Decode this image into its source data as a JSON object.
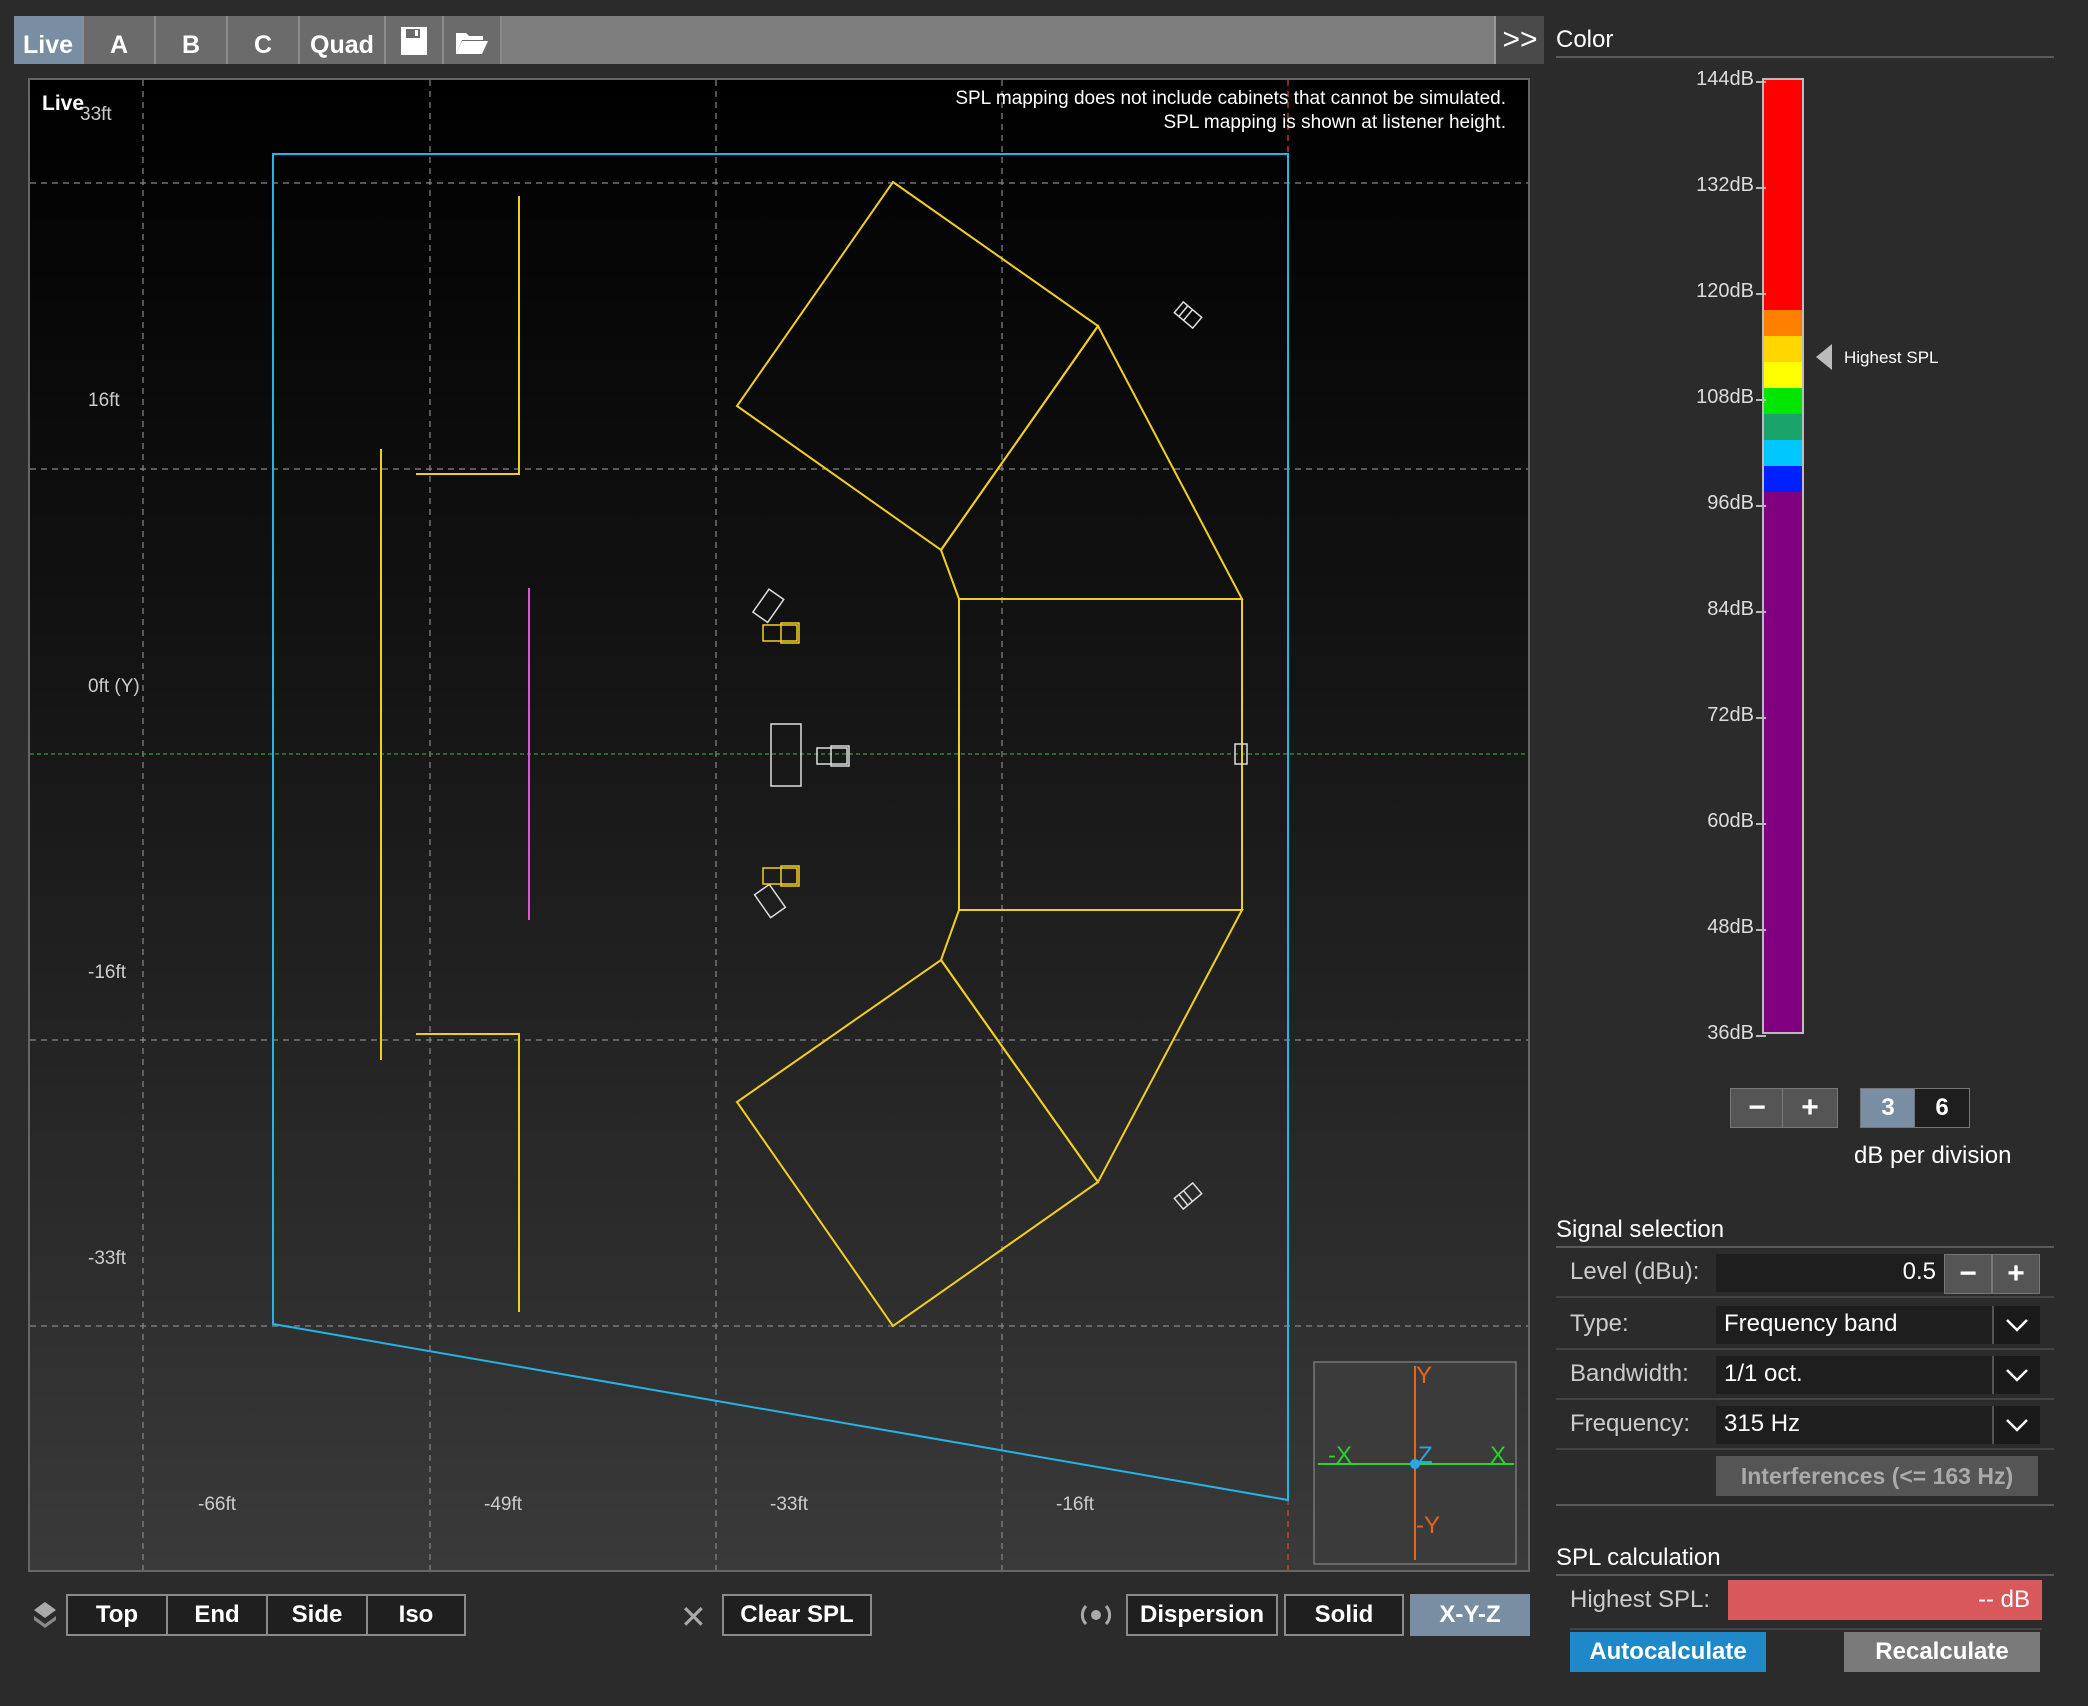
{
  "tabs": [
    {
      "label": "Live",
      "active": true
    },
    {
      "label": "A"
    },
    {
      "label": "B"
    },
    {
      "label": "C"
    },
    {
      "label": "Quad"
    }
  ],
  "tab_icons": [
    "save-icon",
    "folder-open-icon"
  ],
  "expand_label": ">>",
  "view": {
    "mode_label": "Live",
    "notes": [
      "SPL mapping does not include cabinets that cannot be simulated.",
      "SPL mapping is shown at listener height."
    ],
    "y_labels": [
      "33ft",
      "16ft",
      "0ft (Y)",
      "-16ft",
      "-33ft"
    ],
    "x_labels": [
      "-66ft",
      "-49ft",
      "-33ft",
      "-16ft"
    ],
    "axes_widget": {
      "y_pos": "Y",
      "y_neg": "-Y",
      "x_pos": "X",
      "x_neg": "-X",
      "z": "Z"
    }
  },
  "bottom_bar": {
    "view_buttons": [
      "Top",
      "End",
      "Side",
      "Iso"
    ],
    "clear_label": "Clear SPL",
    "render_buttons": [
      {
        "label": "Dispersion"
      },
      {
        "label": "Solid"
      },
      {
        "label": "X-Y-Z",
        "selected": true
      }
    ]
  },
  "color_panel": {
    "title": "Color",
    "scale_labels": [
      "144dB",
      "132dB",
      "120dB",
      "108dB",
      "96dB",
      "84dB",
      "72dB",
      "60dB",
      "48dB",
      "36dB"
    ],
    "highest_spl_marker": "Highest SPL",
    "minus": "−",
    "plus": "+",
    "division_options": [
      "3",
      "6"
    ],
    "division_selected": "3",
    "division_caption": "dB per division",
    "colors": {
      "red": "#ff0000",
      "orange": "#ff7f00",
      "yellow": "#ffd600",
      "yellow2": "#ffff00",
      "green": "#00e600",
      "teal": "#1aa36b",
      "cyan": "#00c8ff",
      "blue": "#0020ff",
      "purple": "#800080"
    }
  },
  "signal": {
    "title": "Signal selection",
    "level_label": "Level (dBu):",
    "level_value": "0.5",
    "type_label": "Type:",
    "type_value": "Frequency band",
    "bandwidth_label": "Bandwidth:",
    "bandwidth_value": "1/1 oct.",
    "frequency_label": "Frequency:",
    "frequency_value": "315 Hz",
    "interferences_label": "Interferences (<= 163 Hz)"
  },
  "spl_calc": {
    "title": "SPL calculation",
    "highest_label": "Highest SPL:",
    "highest_value": "-- dB",
    "autocalc_label": "Autocalculate",
    "recalc_label": "Recalculate"
  }
}
